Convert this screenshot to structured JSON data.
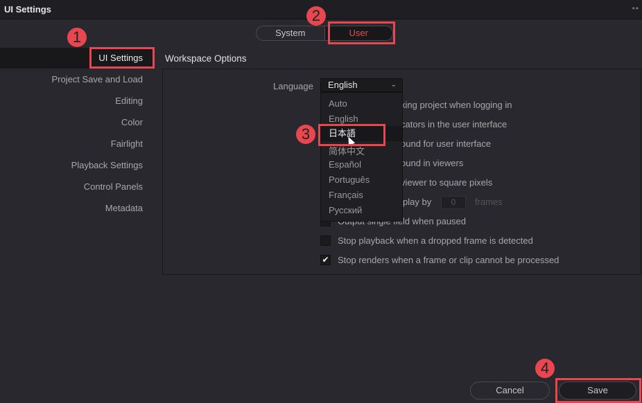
{
  "window": {
    "title": "UI Settings",
    "menu_icon": "more-dots-icon"
  },
  "scope_toggle": {
    "options": [
      "System",
      "User"
    ],
    "selected": "User"
  },
  "sidebar": {
    "items": [
      {
        "label": "UI Settings",
        "active": true
      },
      {
        "label": "Project Save and Load"
      },
      {
        "label": "Editing"
      },
      {
        "label": "Color"
      },
      {
        "label": "Fairlight"
      },
      {
        "label": "Playback Settings"
      },
      {
        "label": "Control Panels"
      },
      {
        "label": "Metadata"
      }
    ]
  },
  "section_title": "Workspace Options",
  "language": {
    "label": "Language",
    "value": "English",
    "options": [
      "Auto",
      "English",
      "日本語",
      "简体中文",
      "Español",
      "Português",
      "Français",
      "Русский"
    ],
    "highlighted": "日本語"
  },
  "options_visible": [
    {
      "text": "king project when logging in"
    },
    {
      "text": "cators in the user interface"
    },
    {
      "text": "ound for user interface"
    },
    {
      "text": "ound in viewers"
    },
    {
      "text": "viewer to square pixels"
    },
    {
      "text": "play by",
      "input_value": "0",
      "suffix": "frames"
    },
    {
      "text": "Output single field when paused",
      "checked": false
    },
    {
      "text": "Stop playback when a dropped frame is detected",
      "checked": false
    },
    {
      "text": "Stop renders when a frame or clip cannot be processed",
      "checked": true
    }
  ],
  "buttons": {
    "cancel": "Cancel",
    "save": "Save"
  },
  "annotations": {
    "colors": {
      "accent": "#e8474f"
    },
    "steps": [
      "1",
      "2",
      "3",
      "4"
    ]
  }
}
